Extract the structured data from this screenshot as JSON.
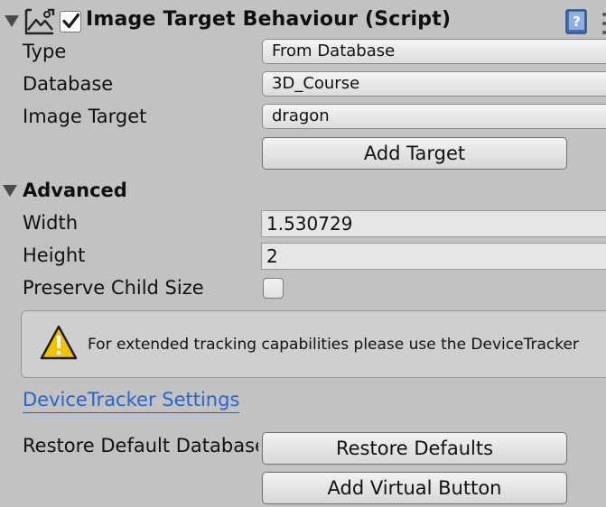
{
  "header": {
    "component_icon": "image-target-icon",
    "enabled": true,
    "title": "Image Target Behaviour (Script)",
    "help_icon": "help-book-icon"
  },
  "fields": {
    "type_label": "Type",
    "type_value": "From Database",
    "database_label": "Database",
    "database_value": "3D_Course",
    "image_target_label": "Image Target",
    "image_target_value": "dragon",
    "add_target_label": "Add Target"
  },
  "advanced": {
    "title": "Advanced",
    "width_label": "Width",
    "width_value": "1.530729",
    "height_label": "Height",
    "height_value": "2",
    "preserve_child_size_label": "Preserve Child Size",
    "preserve_child_size_checked": false
  },
  "help_box": {
    "icon": "warning-icon",
    "text": "For extended tracking capabilities please use the DeviceTracker"
  },
  "link": {
    "label": "DeviceTracker Settings"
  },
  "footer": {
    "restore_label": "Restore Default Database",
    "restore_button": "Restore Defaults",
    "add_virtual_button": "Add Virtual Button"
  }
}
